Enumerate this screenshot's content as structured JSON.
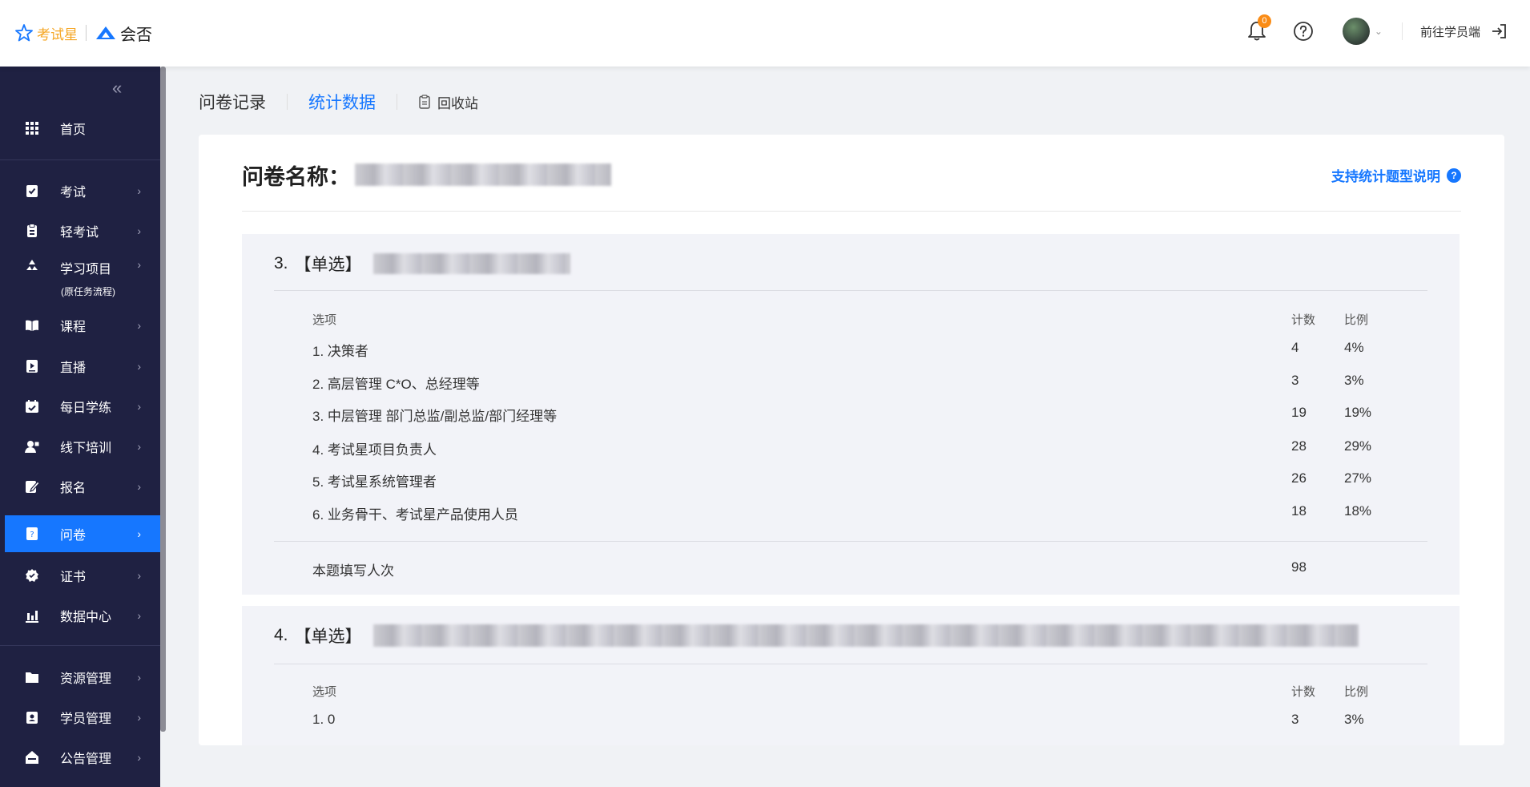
{
  "header": {
    "logo_primary": "考试星",
    "logo_secondary": "会否",
    "notification_count": "0",
    "goto_student": "前往学员端"
  },
  "sidebar": {
    "items": [
      {
        "label": "首页",
        "icon": "grid-icon"
      },
      {
        "label": "考试",
        "icon": "clipboard-check-icon"
      },
      {
        "label": "轻考试",
        "icon": "clipboard-icon"
      },
      {
        "label": "学习项目",
        "sub": "(原任务流程)",
        "icon": "recycle-icon"
      },
      {
        "label": "课程",
        "icon": "book-icon"
      },
      {
        "label": "直播",
        "icon": "live-icon"
      },
      {
        "label": "每日学练",
        "icon": "calendar-icon"
      },
      {
        "label": "线下培训",
        "icon": "user-card-icon"
      },
      {
        "label": "报名",
        "icon": "edit-icon"
      },
      {
        "label": "问卷",
        "icon": "survey-icon"
      },
      {
        "label": "证书",
        "icon": "badge-icon"
      },
      {
        "label": "数据中心",
        "icon": "bar-chart-icon"
      },
      {
        "label": "资源管理",
        "icon": "folder-icon"
      },
      {
        "label": "学员管理",
        "icon": "id-card-icon"
      },
      {
        "label": "公告管理",
        "icon": "announce-icon"
      }
    ],
    "active": "问卷"
  },
  "tabs": {
    "records": "问卷记录",
    "stats": "统计数据",
    "recycle": "回收站"
  },
  "survey": {
    "title_label": "问卷名称：",
    "support_link": "支持统计题型说明"
  },
  "questions": [
    {
      "number": "3.",
      "type": "【单选】",
      "col_option": "选项",
      "col_count": "计数",
      "col_ratio": "比例",
      "options": [
        {
          "label": "1. 决策者",
          "count": "4",
          "ratio": "4%"
        },
        {
          "label": "2. 高层管理 C*O、总经理等",
          "count": "3",
          "ratio": "3%"
        },
        {
          "label": "3. 中层管理 部门总监/副总监/部门经理等",
          "count": "19",
          "ratio": "19%"
        },
        {
          "label": "4. 考试星项目负责人",
          "count": "28",
          "ratio": "29%"
        },
        {
          "label": "5. 考试星系统管理者",
          "count": "26",
          "ratio": "27%"
        },
        {
          "label": "6. 业务骨干、考试星产品使用人员",
          "count": "18",
          "ratio": "18%"
        }
      ],
      "total_label": "本题填写人次",
      "total": "98"
    },
    {
      "number": "4.",
      "type": "【单选】",
      "col_option": "选项",
      "col_count": "计数",
      "col_ratio": "比例",
      "options": [
        {
          "label": "1. 0",
          "count": "3",
          "ratio": "3%"
        }
      ]
    }
  ]
}
